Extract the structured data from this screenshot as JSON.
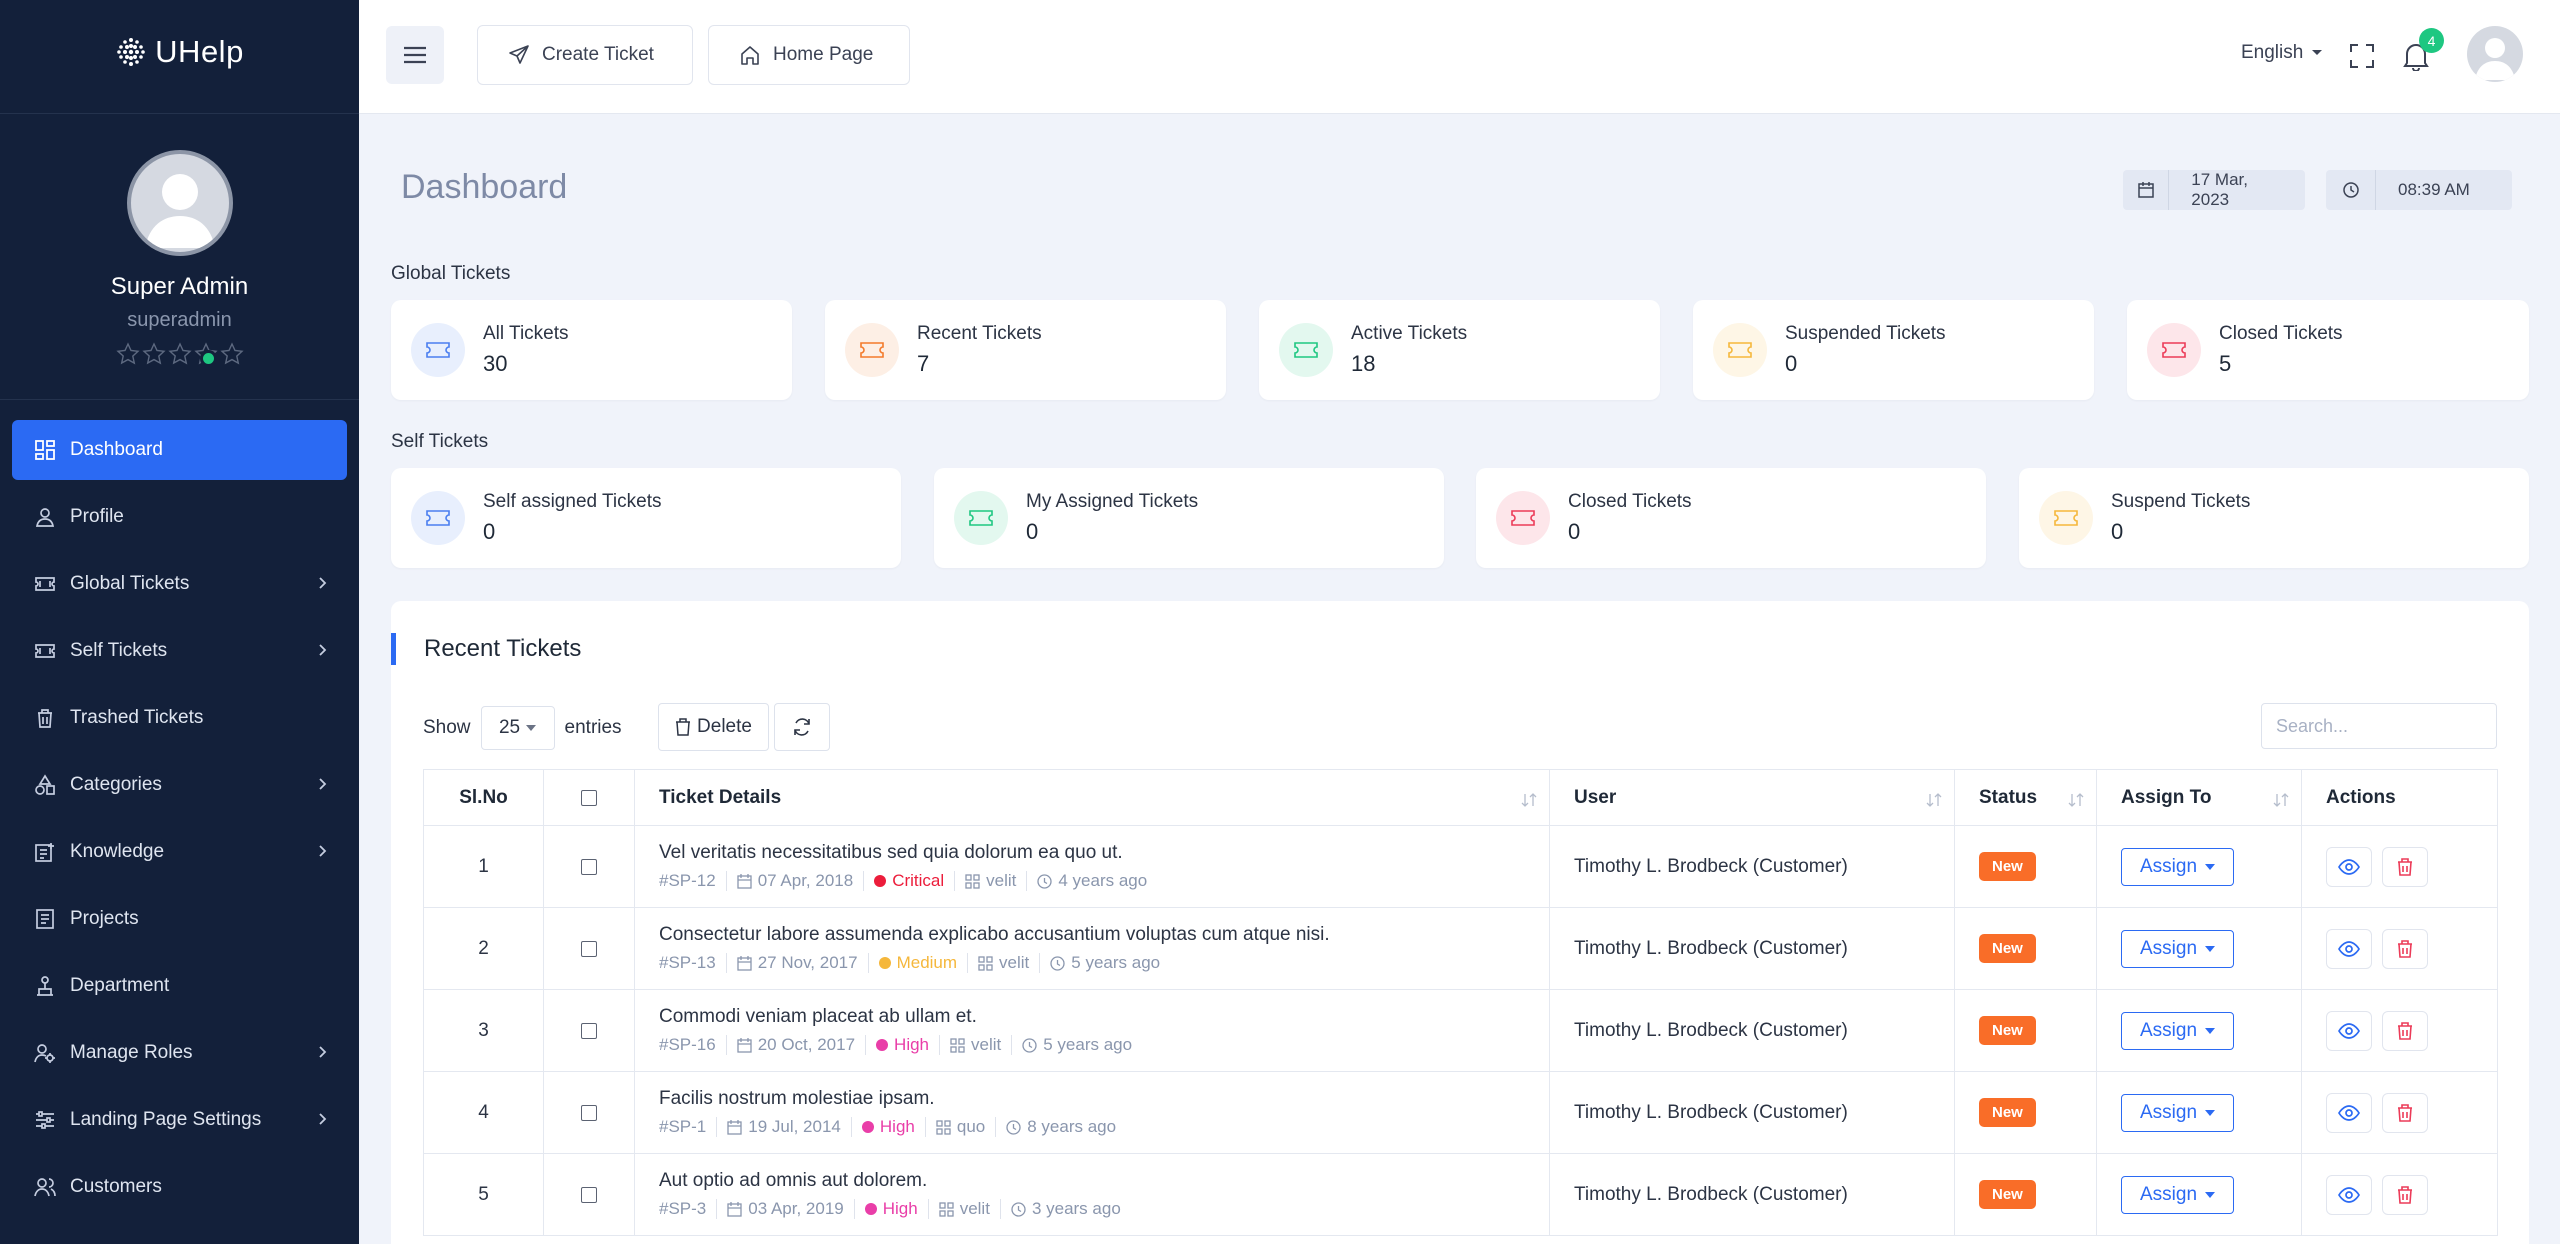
{
  "brand": {
    "name": "UHelp"
  },
  "user": {
    "name": "Super Admin",
    "role": "superadmin"
  },
  "sidebar": {
    "items": [
      {
        "label": "Dashboard"
      },
      {
        "label": "Profile"
      },
      {
        "label": "Global Tickets"
      },
      {
        "label": "Self Tickets"
      },
      {
        "label": "Trashed Tickets"
      },
      {
        "label": "Categories"
      },
      {
        "label": "Knowledge"
      },
      {
        "label": "Projects"
      },
      {
        "label": "Department"
      },
      {
        "label": "Manage Roles"
      },
      {
        "label": "Landing Page Settings"
      },
      {
        "label": "Customers"
      }
    ]
  },
  "topbar": {
    "create_ticket": "Create Ticket",
    "home_page": "Home Page",
    "language": "English",
    "notification_count": "4"
  },
  "page": {
    "title": "Dashboard",
    "date": "17 Mar, 2023",
    "time": "08:39 AM"
  },
  "global_tickets": {
    "label": "Global Tickets",
    "cards": [
      {
        "label": "All Tickets",
        "value": "30",
        "color": "#4a7ef0"
      },
      {
        "label": "Recent Tickets",
        "value": "7",
        "color": "#f37a2b"
      },
      {
        "label": "Active Tickets",
        "value": "18",
        "color": "#1ec781"
      },
      {
        "label": "Suspended Tickets",
        "value": "0",
        "color": "#f5b73b"
      },
      {
        "label": "Closed Tickets",
        "value": "5",
        "color": "#ec3b58"
      }
    ]
  },
  "self_tickets": {
    "label": "Self Tickets",
    "cards": [
      {
        "label": "Self assigned Tickets",
        "value": "0",
        "color": "#4a7ef0"
      },
      {
        "label": "My Assigned Tickets",
        "value": "0",
        "color": "#1ec781"
      },
      {
        "label": "Closed Tickets",
        "value": "0",
        "color": "#ec3b58"
      },
      {
        "label": "Suspend Tickets",
        "value": "0",
        "color": "#f5b73b"
      }
    ]
  },
  "recent": {
    "title": "Recent Tickets",
    "show_label": "Show",
    "page_size": "25",
    "entries_label": "entries",
    "delete_label": "Delete",
    "search_placeholder": "Search...",
    "columns": [
      "Sl.No",
      "Ticket Details",
      "User",
      "Status",
      "Assign To",
      "Actions"
    ],
    "rows": [
      {
        "no": "1",
        "title": "Vel veritatis necessitatibus sed quia dolorum ea quo ut.",
        "id": "#SP-12",
        "date": "07 Apr, 2018",
        "priority": "Critical",
        "priority_color": "#ec1d3b",
        "category": "velit",
        "ago": "4 years ago",
        "user": "Timothy L. Brodbeck (Customer)",
        "status": "New",
        "assign": "Assign"
      },
      {
        "no": "2",
        "title": "Consectetur labore assumenda explicabo accusantium voluptas cum atque nisi.",
        "id": "#SP-13",
        "date": "27 Nov, 2017",
        "priority": "Medium",
        "priority_color": "#f5b73b",
        "category": "velit",
        "ago": "5 years ago",
        "user": "Timothy L. Brodbeck (Customer)",
        "status": "New",
        "assign": "Assign"
      },
      {
        "no": "3",
        "title": "Commodi veniam placeat ab ullam et.",
        "id": "#SP-16",
        "date": "20 Oct, 2017",
        "priority": "High",
        "priority_color": "#e93ea8",
        "category": "velit",
        "ago": "5 years ago",
        "user": "Timothy L. Brodbeck (Customer)",
        "status": "New",
        "assign": "Assign"
      },
      {
        "no": "4",
        "title": "Facilis nostrum molestiae ipsam.",
        "id": "#SP-1",
        "date": "19 Jul, 2014",
        "priority": "High",
        "priority_color": "#e93ea8",
        "category": "quo",
        "ago": "8 years ago",
        "user": "Timothy L. Brodbeck (Customer)",
        "status": "New",
        "assign": "Assign"
      },
      {
        "no": "5",
        "title": "Aut optio ad omnis aut dolorem.",
        "id": "#SP-3",
        "date": "03 Apr, 2019",
        "priority": "High",
        "priority_color": "#e93ea8",
        "category": "velit",
        "ago": "3 years ago",
        "user": "Timothy L. Brodbeck (Customer)",
        "status": "New",
        "assign": "Assign"
      }
    ]
  },
  "colors": {
    "accent": "#2b6af3",
    "sidebar_bg": "#13203a",
    "status_new": "#f96d28",
    "online": "#1ec781"
  }
}
